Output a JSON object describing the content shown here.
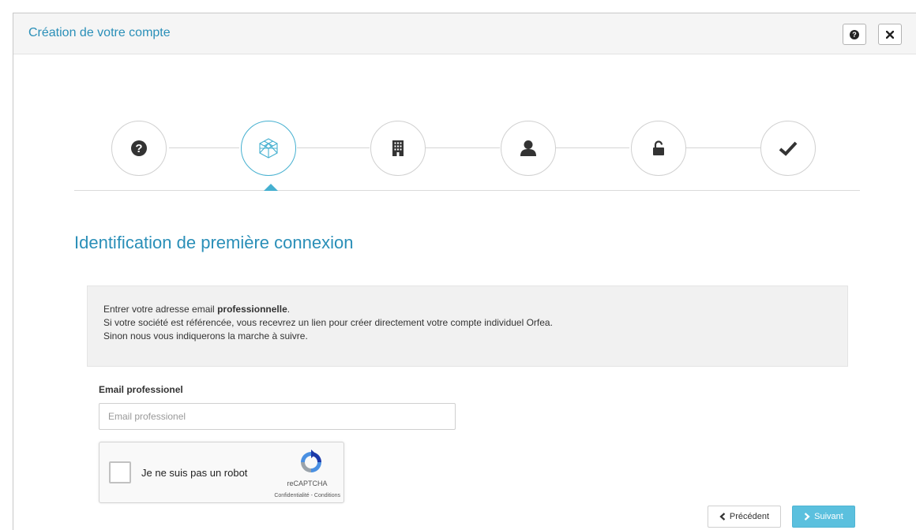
{
  "header": {
    "title": "Création de votre compte"
  },
  "colors": {
    "accent": "#2a8fb8",
    "active_step": "#45b0d0",
    "primary_button": "#5bc0de"
  },
  "stepper": {
    "steps": [
      {
        "icon": "question-circle-icon",
        "active": false
      },
      {
        "icon": "cube-outline-icon",
        "active": true
      },
      {
        "icon": "building-icon",
        "active": false
      },
      {
        "icon": "user-icon",
        "active": false
      },
      {
        "icon": "unlock-icon",
        "active": false
      },
      {
        "icon": "check-icon",
        "active": false
      }
    ]
  },
  "main": {
    "section_title": "Identification de première connexion",
    "info": {
      "line1_prefix": "Entrer votre adresse email ",
      "line1_bold": "professionnelle",
      "line1_suffix": ".",
      "line2": "Si votre société est référencée, vous recevrez un lien pour créer directement votre compte individuel Orfea.",
      "line3": "Sinon nous vous indiquerons la marche à suivre."
    },
    "email": {
      "label": "Email professionel",
      "placeholder": "Email professionel",
      "value": ""
    },
    "recaptcha": {
      "checkbox_label": "Je ne suis pas un robot",
      "brand": "reCAPTCHA",
      "links": "Confidentialité - Conditions"
    }
  },
  "footer": {
    "prev_label": "Précédent",
    "next_label": "Suivant"
  }
}
